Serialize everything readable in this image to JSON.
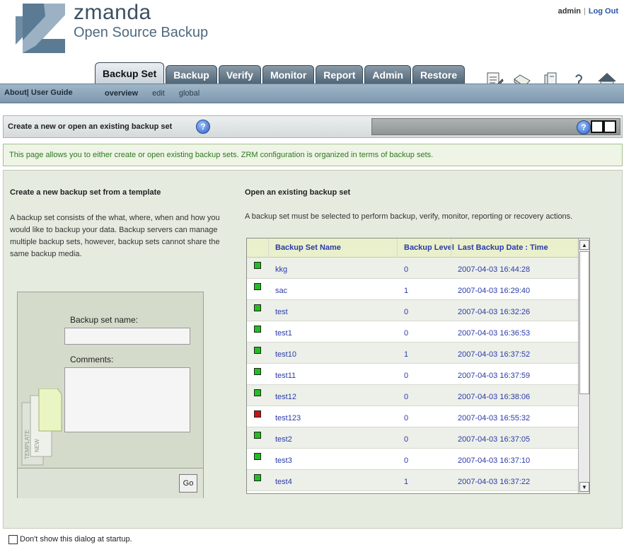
{
  "brand": {
    "name": "zmanda",
    "subtitle": "Open Source Backup"
  },
  "user": {
    "name": "admin",
    "separator": "|",
    "logout": "Log Out"
  },
  "tabs": [
    {
      "label": "Backup Set",
      "active": true
    },
    {
      "label": "Backup",
      "active": false
    },
    {
      "label": "Verify",
      "active": false
    },
    {
      "label": "Monitor",
      "active": false
    },
    {
      "label": "Report",
      "active": false
    },
    {
      "label": "Admin",
      "active": false
    },
    {
      "label": "Restore",
      "active": false
    }
  ],
  "toplinks": {
    "about": "About",
    "separator": "|",
    "guide": "User Guide"
  },
  "subnav": [
    {
      "label": "overview",
      "active": true
    },
    {
      "label": "edit",
      "active": false
    },
    {
      "label": "global",
      "active": false
    }
  ],
  "titlebar": {
    "title": "Create a new or open an existing backup set",
    "help": "?"
  },
  "info": "This page allows you to either create or open existing backup sets. ZRM configuration is organized in terms of backup sets.",
  "left": {
    "heading": "Create a new backup set from a template",
    "description": "A backup set consists of the what, where, when and how you would like to backup your data. Backup servers can manage multiple backup sets, however, backup sets cannot share the same backup media.",
    "name_label": "Backup set name:",
    "name_value": "",
    "comments_label": "Comments:",
    "comments_value": "",
    "go": "Go",
    "template_text1": "TEMPLATE",
    "template_text2": "NEW"
  },
  "right": {
    "heading": "Open an existing backup set",
    "description": "A backup set must be selected to perform backup, verify, monitor, reporting or recovery actions."
  },
  "table": {
    "columns": [
      "Backup Set Name",
      "Backup Level",
      "Last Backup Date : Time"
    ],
    "rows": [
      {
        "status": "green",
        "name": "kkg",
        "level": "0",
        "date": "2007-04-03 16:44:28"
      },
      {
        "status": "green",
        "name": "sac",
        "level": "1",
        "date": "2007-04-03 16:29:40"
      },
      {
        "status": "green",
        "name": "test",
        "level": "0",
        "date": "2007-04-03 16:32:26"
      },
      {
        "status": "green",
        "name": "test1",
        "level": "0",
        "date": "2007-04-03 16:36:53"
      },
      {
        "status": "green",
        "name": "test10",
        "level": "1",
        "date": "2007-04-03 16:37:52"
      },
      {
        "status": "green",
        "name": "test11",
        "level": "0",
        "date": "2007-04-03 16:37:59"
      },
      {
        "status": "green",
        "name": "test12",
        "level": "0",
        "date": "2007-04-03 16:38:06"
      },
      {
        "status": "red",
        "name": "test123",
        "level": "0",
        "date": "2007-04-03 16:55:32"
      },
      {
        "status": "green",
        "name": "test2",
        "level": "0",
        "date": "2007-04-03 16:37:05"
      },
      {
        "status": "green",
        "name": "test3",
        "level": "0",
        "date": "2007-04-03 16:37:10"
      },
      {
        "status": "green",
        "name": "test4",
        "level": "1",
        "date": "2007-04-03 16:37:22"
      }
    ]
  },
  "status_colors": {
    "green": "#1fbf1f",
    "red": "#cc1111"
  },
  "bottom": {
    "checkbox_label": "Don't show this dialog at startup."
  }
}
